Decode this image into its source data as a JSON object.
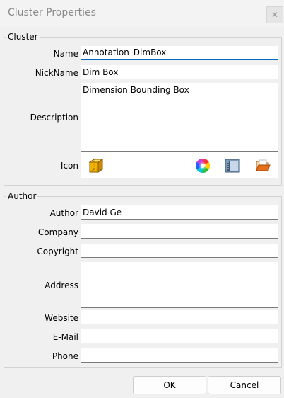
{
  "window": {
    "title": "Cluster Properties",
    "close_glyph": "✕"
  },
  "cluster": {
    "legend": "Cluster",
    "name_label": "Name",
    "name_value": "Annotation_DimBox",
    "nickname_label": "NickName",
    "nickname_value": "Dim Box",
    "description_label": "Description",
    "description_value": "Dimension Bounding Box",
    "icon_label": "Icon",
    "icon_preview": "cube-icon",
    "icon_tools": [
      "color-wheel-icon",
      "panel-icon",
      "open-folder-icon"
    ]
  },
  "author": {
    "legend": "Author",
    "author_label": "Author",
    "author_value": "David Ge",
    "company_label": "Company",
    "company_value": "",
    "copyright_label": "Copyright",
    "copyright_value": "",
    "address_label": "Address",
    "address_value": "",
    "website_label": "Website",
    "website_value": "",
    "email_label": "E-Mail",
    "email_value": "",
    "phone_label": "Phone",
    "phone_value": ""
  },
  "buttons": {
    "ok": "OK",
    "cancel": "Cancel"
  },
  "colors": {
    "focus_accent": "#0067c0",
    "cube_fill": "#f0b400"
  }
}
